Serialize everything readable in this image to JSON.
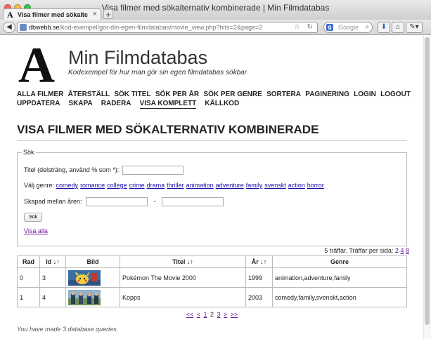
{
  "browser": {
    "window_title": "Visa filmer med sökalternativ kombinerade | Min Filmdatabas",
    "tab_title": "Visa filmer med sökalternativ k...",
    "tab_favicon": "A",
    "newtab_label": "+",
    "url_host": "dbwebb.se",
    "url_path": "/kod-exempel/gor-din-egen-filmdatabas/movie_view.php?hits=2&page=2",
    "search_placeholder": "Google"
  },
  "site": {
    "logo_letter": "A",
    "title": "Min Filmdatabas",
    "slogan": "Kodexempel för hur man gör sin egen filmdatabas sökbar"
  },
  "menu": {
    "row1": [
      "ALLA FILMER",
      "ÅTERSTÄLL",
      "SÖK TITEL",
      "SÖK PER ÅR",
      "SÖK PER GENRE",
      "SORTERA",
      "PAGINERING",
      "LOGIN",
      "LOGOUT"
    ],
    "row2": [
      "UPPDATERA",
      "SKAPA",
      "RADERA",
      "VISA KOMPLETT",
      "KÄLLKOD"
    ],
    "selected": "VISA KOMPLETT"
  },
  "heading": "VISA FILMER MED SÖKALTERNATIV KOMBINERADE",
  "search_form": {
    "legend": "Sök",
    "title_label": "Titel (delsträng, använd % som *):",
    "title_value": "",
    "genre_label": "Välj genre:",
    "genres": [
      "comedy",
      "romance",
      "college",
      "crime",
      "drama",
      "thriller",
      "animation",
      "adventure",
      "family",
      "svenskt",
      "action",
      "horror"
    ],
    "year_label": "Skapad mellan åren:",
    "year_from": "",
    "year_dash": "-",
    "year_to": "",
    "submit_label": "Sök",
    "show_all_label": "Visa alla"
  },
  "hits": {
    "text": "5 träffar. Träffar per sida:",
    "options": [
      "2",
      "4",
      "8"
    ],
    "current": "2"
  },
  "table": {
    "columns": [
      "Rad",
      "Id ↓↑",
      "Bild",
      "Titel ↓↑",
      "År ↓↑",
      "Genre"
    ],
    "rows": [
      {
        "rad": "0",
        "id": "3",
        "image": "pikachu-thumbnail",
        "title": "Pokémon The Movie 2000",
        "year": "1999",
        "genre": "animation,adventure,family"
      },
      {
        "rad": "1",
        "id": "4",
        "image": "kopps-thumbnail",
        "title": "Kopps",
        "year": "2003",
        "genre": "comedy,family,svenskt,action"
      }
    ]
  },
  "pager": {
    "first": "<<",
    "prev": "<",
    "pages": [
      "1",
      "2",
      "3"
    ],
    "current": "2",
    "next": ">",
    "last": ">>"
  },
  "footer_note": "You have made 3 database queries.",
  "colors": {
    "link": "#1a0dab",
    "visited": "#6a1b9a",
    "text": "#222222"
  }
}
